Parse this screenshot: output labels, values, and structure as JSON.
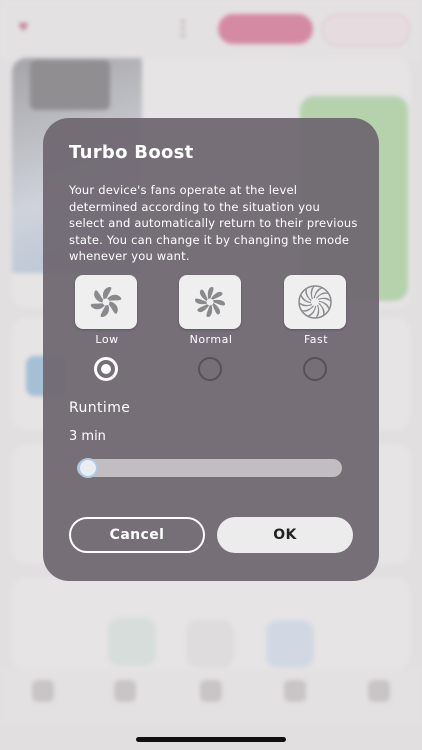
{
  "dialog": {
    "title": "Turbo Boost",
    "description": "Your device's fans operate at the level determined according to the situation you select and automatically return to their previous state. You can change it by changing the mode whenever you want.",
    "modes": [
      {
        "label": "Low",
        "icon": "fan-low-icon",
        "selected": true
      },
      {
        "label": "Normal",
        "icon": "fan-normal-icon",
        "selected": false
      },
      {
        "label": "Fast",
        "icon": "fan-fast-icon",
        "selected": false
      }
    ],
    "runtime_label": "Runtime",
    "runtime_value": "3 min",
    "runtime_slider_fraction": 0.0,
    "cancel_label": "Cancel",
    "ok_label": "OK"
  },
  "colors": {
    "dialog_bg": "#6e6670",
    "accent_pink": "#d6336c",
    "ok_bg": "#ececec"
  }
}
